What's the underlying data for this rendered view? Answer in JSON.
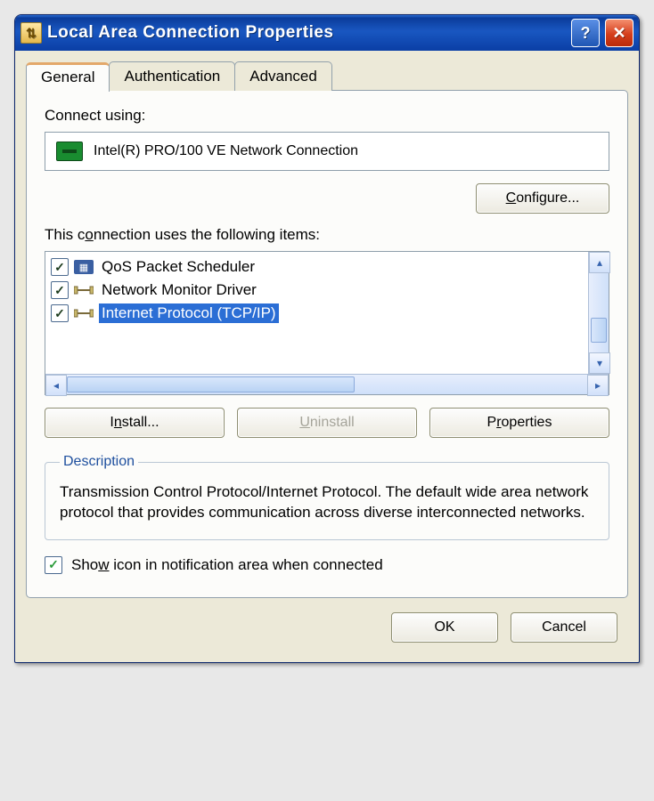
{
  "window": {
    "title": "Local Area Connection Properties"
  },
  "tabs": {
    "general": "General",
    "authentication": "Authentication",
    "advanced": "Advanced"
  },
  "connect_using": {
    "label": "Connect using:",
    "adapter": "Intel(R) PRO/100 VE Network Connection",
    "configure": "Configure..."
  },
  "items": {
    "label": "This connection uses the following items:",
    "rows": [
      {
        "checked": true,
        "icon": "scheduler",
        "label": "QoS Packet Scheduler",
        "selected": false
      },
      {
        "checked": true,
        "icon": "netmon",
        "label": "Network Monitor Driver",
        "selected": false
      },
      {
        "checked": true,
        "icon": "protocol",
        "label": "Internet Protocol (TCP/IP)",
        "selected": true
      }
    ]
  },
  "buttons": {
    "install": "Install...",
    "uninstall": "Uninstall",
    "properties": "Properties"
  },
  "description": {
    "legend": "Description",
    "text": "Transmission Control Protocol/Internet Protocol. The default wide area network protocol that provides communication across diverse interconnected networks."
  },
  "notify": {
    "checked": true,
    "label": "Show icon in notification area when connected"
  },
  "footer": {
    "ok": "OK",
    "cancel": "Cancel"
  }
}
